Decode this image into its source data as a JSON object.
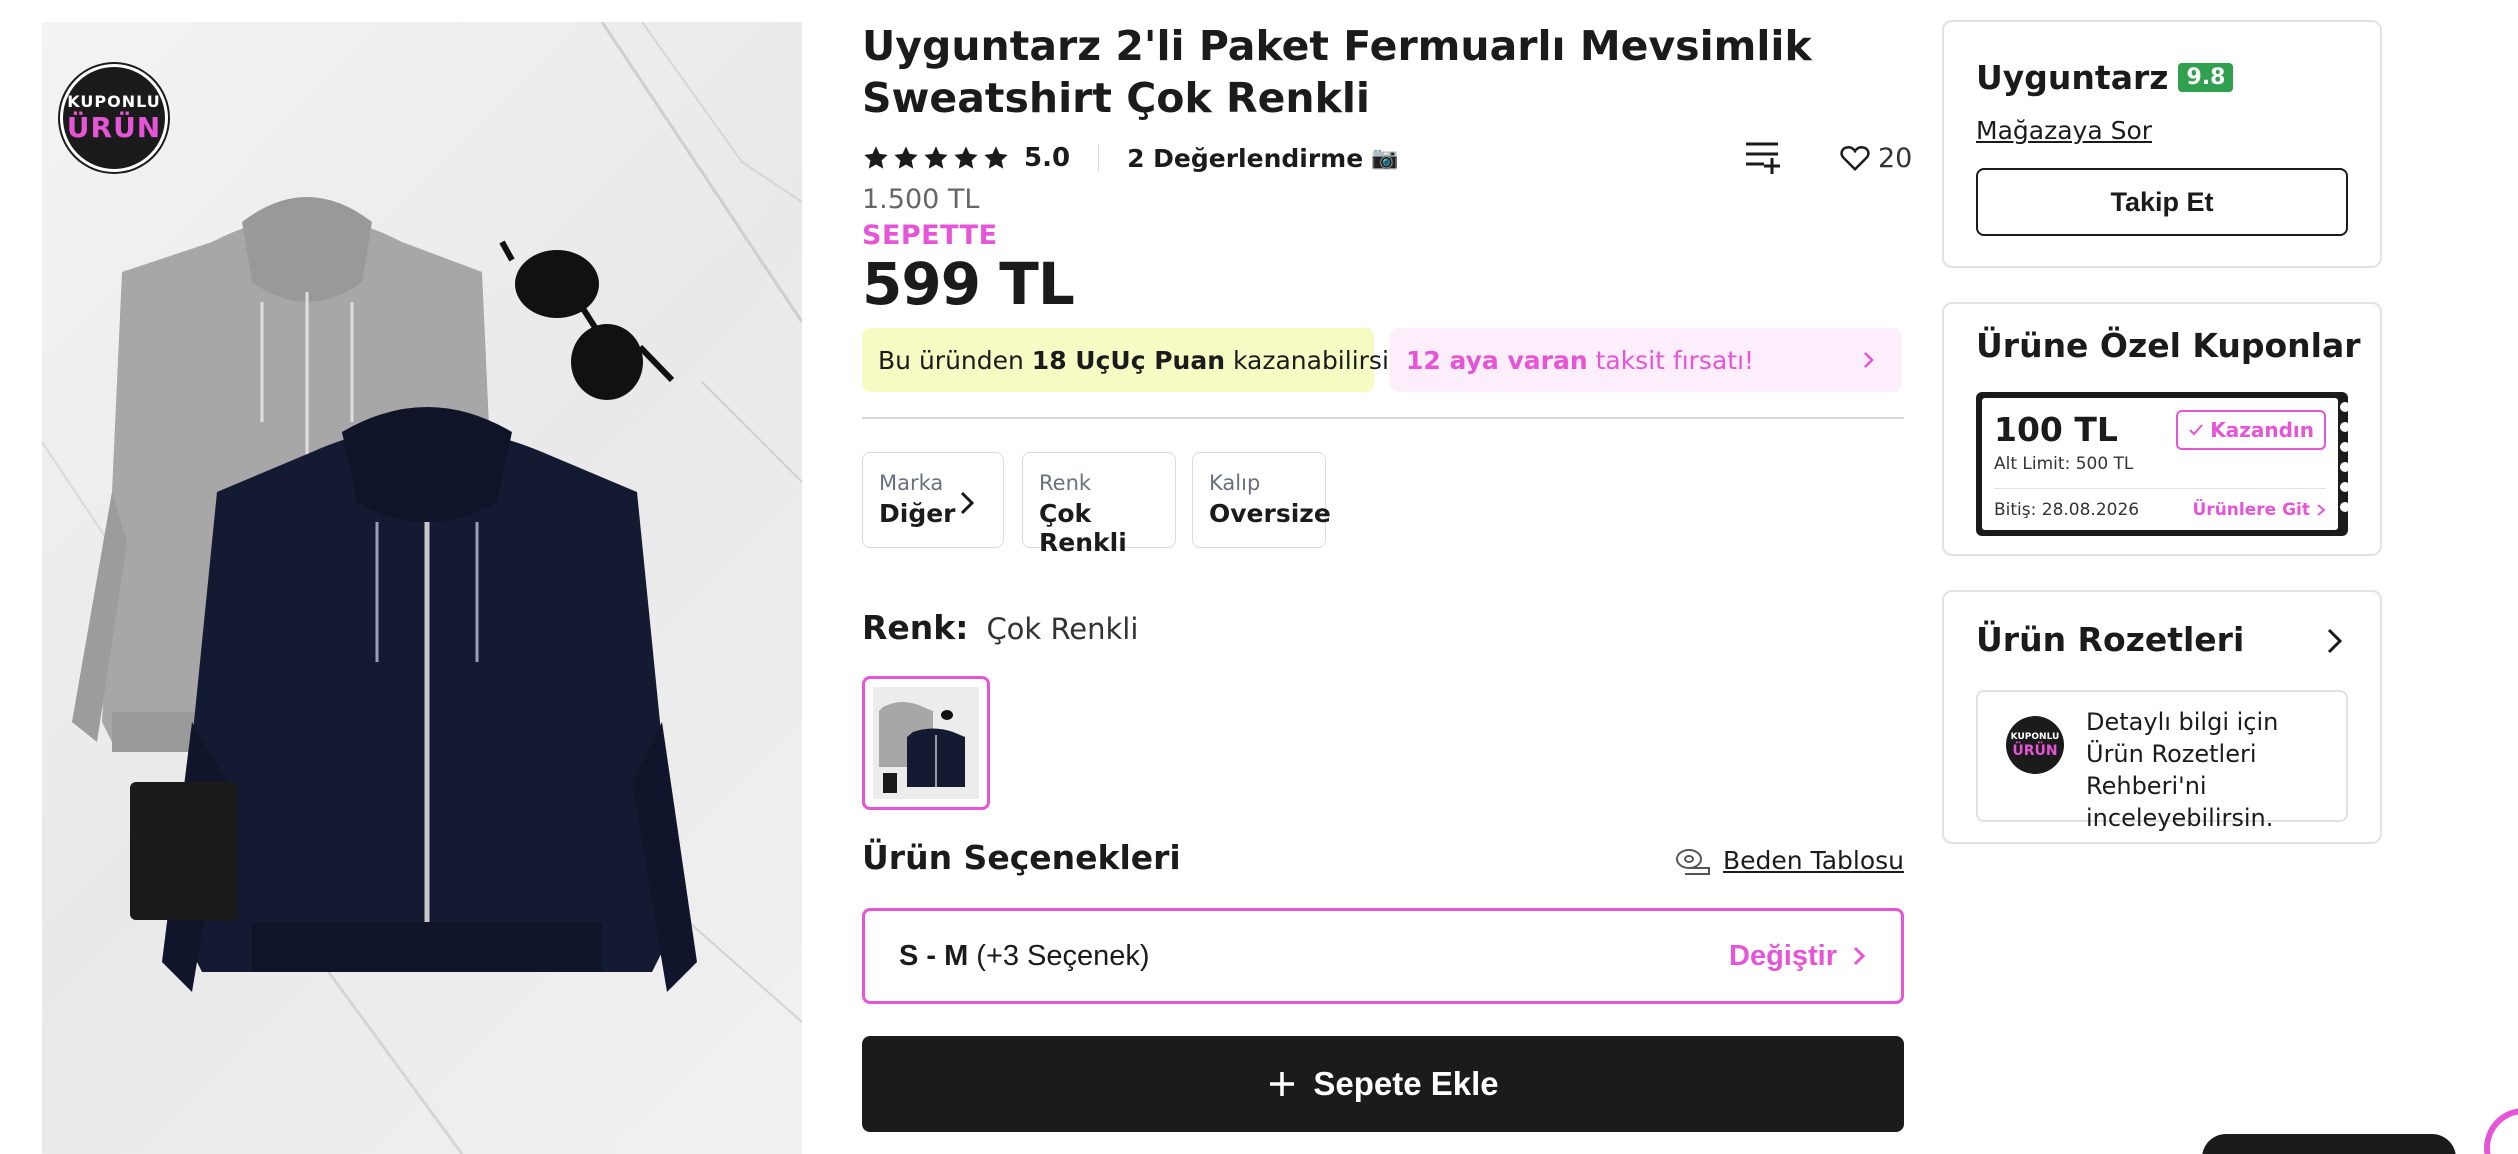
{
  "product": {
    "title": "Uyguntarz 2'li Paket Fermuarlı Mevsimlik Sweatshirt Çok Renkli",
    "badge_line1": "KUPONLU",
    "badge_line2": "ÜRÜN",
    "rating": "5.0",
    "stars": 5,
    "review_count": "2 Değerlendirme",
    "camera_icon": "📷",
    "favorite_count": "20",
    "old_price": "1.500 TL",
    "sepette_label": "SEPETTE",
    "price": "599 TL"
  },
  "promos": {
    "puan_prefix": "Bu üründen ",
    "puan_bold": "18 UçUç Puan",
    "puan_suffix": " kazanabilirsin.",
    "taksit_bold": "12 aya varan",
    "taksit_suffix": " taksit fırsatı!"
  },
  "attributes": [
    {
      "key": "Marka",
      "value": "Diğer"
    },
    {
      "key": "Renk",
      "value": "Çok Renkli"
    },
    {
      "key": "Kalıp",
      "value": "Oversize"
    }
  ],
  "color": {
    "label": "Renk:",
    "value": "Çok Renkli"
  },
  "options": {
    "title": "Ürün Seçenekleri",
    "size_chart_label": "Beden Tablosu",
    "selected_size": "S - M",
    "extra_options": "(+3 Seçenek)",
    "change_label": "Değiştir"
  },
  "cart": {
    "add_label": "Sepete Ekle"
  },
  "store": {
    "name": "Uyguntarz",
    "score": "9.8",
    "ask_label": "Mağazaya Sor",
    "follow_label": "Takip Et"
  },
  "coupons": {
    "title": "Ürüne Özel Kuponlar",
    "amount": "100 TL",
    "limit": "Alt Limit: 500 TL",
    "status": "Kazandın",
    "expiry": "Bitiş: 28.08.2026",
    "go_label": "Ürünlere Git"
  },
  "badges": {
    "title": "Ürün Rozetleri",
    "info_text": "Detaylı bilgi için Ürün Rozetleri Rehberi'ni inceleyebilirsin."
  },
  "colors": {
    "accent": "#e654d7",
    "dark": "#1b1b1b",
    "promo_yellow": "#f6fbc4",
    "promo_pink": "#fdeefb",
    "score_green": "#31a04e"
  }
}
